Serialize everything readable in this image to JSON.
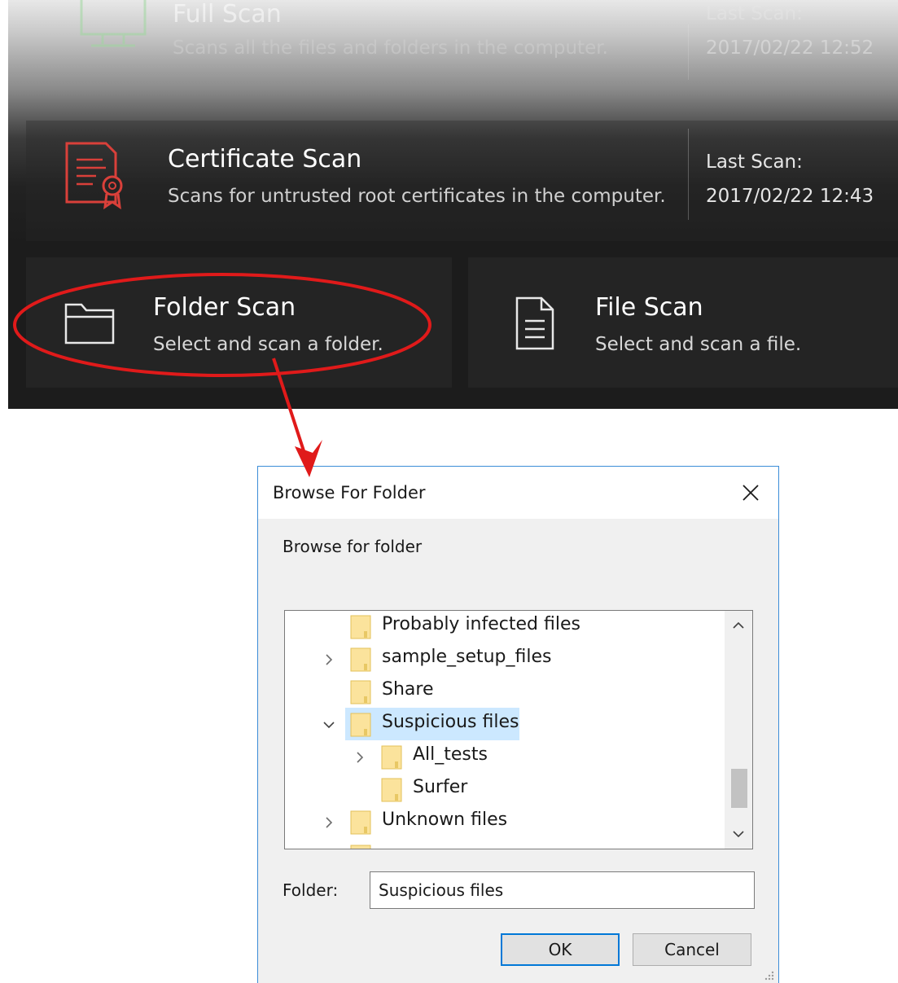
{
  "scans": {
    "full": {
      "title": "Full Scan",
      "description": "Scans all the files and folders in the computer.",
      "last_label": "Last Scan:",
      "last_date": "2017/02/22 12:52"
    },
    "certificate": {
      "title": "Certificate Scan",
      "description": "Scans for untrusted root certificates in the computer.",
      "last_label": "Last Scan:",
      "last_date": "2017/02/22 12:43"
    },
    "folder": {
      "title": "Folder Scan",
      "description": "Select and scan a folder."
    },
    "file": {
      "title": "File Scan",
      "description": "Select and scan a file."
    }
  },
  "dialog": {
    "title": "Browse For Folder",
    "prompt": "Browse for folder",
    "tree": [
      {
        "label": "Probably infected files",
        "expander": "none"
      },
      {
        "label": "sample_setup_files",
        "expander": "collapsed"
      },
      {
        "label": "Share",
        "expander": "none"
      },
      {
        "label": "Suspicious files",
        "expander": "expanded",
        "selected": true
      },
      {
        "label": "All_tests",
        "expander": "collapsed"
      },
      {
        "label": "Surfer",
        "expander": "none"
      },
      {
        "label": "Unknown files",
        "expander": "collapsed"
      }
    ],
    "folder_label": "Folder:",
    "folder_value": "Suspicious files",
    "ok_label": "OK",
    "cancel_label": "Cancel"
  },
  "colors": {
    "annotation_red": "#e01a1a",
    "selection": "#cce8ff",
    "dialog_border": "#3c8dd8",
    "certificate_icon": "#d9403a"
  }
}
